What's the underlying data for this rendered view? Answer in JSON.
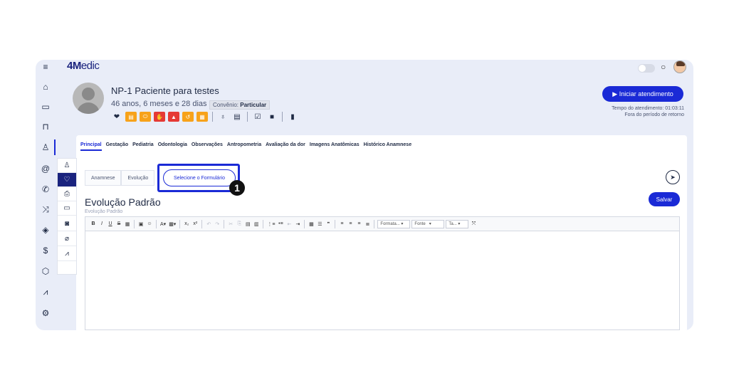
{
  "app": {
    "logo_bold": "4M",
    "logo_light": "edic"
  },
  "sidebar": {
    "items": [
      {
        "name": "menu-icon",
        "glyph": "≡"
      },
      {
        "name": "home-icon",
        "glyph": "⌂"
      },
      {
        "name": "calendar-icon",
        "glyph": "▭"
      },
      {
        "name": "sofa-icon",
        "glyph": "⊓"
      },
      {
        "name": "user-icon",
        "glyph": "♙"
      },
      {
        "name": "at-icon",
        "glyph": "@"
      },
      {
        "name": "phone-icon",
        "glyph": "✆"
      },
      {
        "name": "shuffle-icon",
        "glyph": "⤨"
      },
      {
        "name": "tag-icon",
        "glyph": "◈"
      },
      {
        "name": "dollar-icon",
        "glyph": "$"
      },
      {
        "name": "box-icon",
        "glyph": "⬡"
      },
      {
        "name": "chart-icon",
        "glyph": "⩘"
      },
      {
        "name": "gear-icon",
        "glyph": "⚙"
      }
    ]
  },
  "patient": {
    "name": "NP-1 Paciente para testes",
    "age": "46 anos, 6 meses e 28 dias",
    "convenio_label": "Convênio:",
    "convenio_value": "Particular"
  },
  "actions": {
    "start_label": "▶ Iniciar atendimento",
    "tempo_line1": "Tempo do atendimento: 01:03:11",
    "tempo_line2": "Fora do período de retorno"
  },
  "tabs": [
    "Principal",
    "Gestação",
    "Pediatria",
    "Odontologia",
    "Observações",
    "Antropometria",
    "Avaliação da dor",
    "Imagens Anatômicas",
    "Histórico Anamnese"
  ],
  "subtabs": [
    "Anamnese",
    "Evolução"
  ],
  "select_form_label": "Selecione o Formulário",
  "step_number": "1",
  "save_label": "Salvar",
  "form": {
    "title": "Evolução Padrão",
    "subtitle": "Evolução Padrão"
  },
  "toolbar": {
    "format_label": "Formata...",
    "font_label": "Fonte",
    "size_label": "Ta..."
  },
  "colors": {
    "accent": "#1a2ad6",
    "background": "#e9edf8",
    "badge_orange": "#f7a21a",
    "badge_red": "#e53935"
  }
}
